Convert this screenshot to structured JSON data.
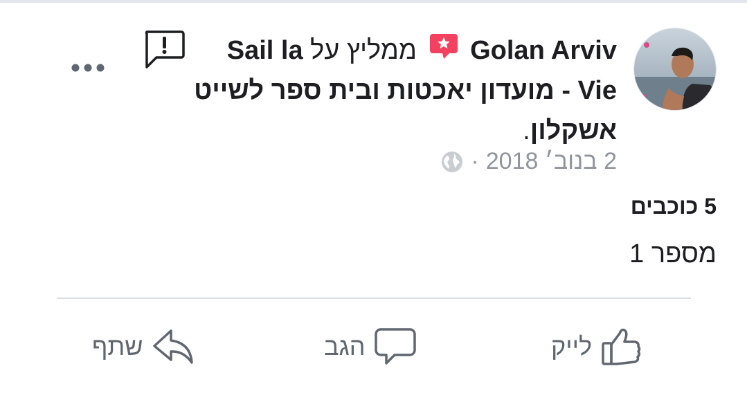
{
  "post": {
    "author": "Golan Arviv",
    "verb": "ממליץ על",
    "page_name": "Sail la Vie - מועדון יאכטות ובית ספר לשייט אשקלון",
    "page_suffix": ".",
    "date": "2 בנוב׳ 2018",
    "separator": "·",
    "rating": "5 כוכבים",
    "text": "מספר 1"
  },
  "icons": {
    "avatar": "avatar",
    "recommend_badge": "recommend-star-badge-icon",
    "privacy": "globe-icon",
    "report": "report-flag-icon",
    "more": "more-options-icon"
  },
  "actions": {
    "like_label": "לייק",
    "comment_label": "הגב",
    "share_label": "שתף"
  },
  "colors": {
    "badge": "#f3425f",
    "muted": "#606770",
    "meta": "#90949c",
    "text": "#1c1e21"
  }
}
